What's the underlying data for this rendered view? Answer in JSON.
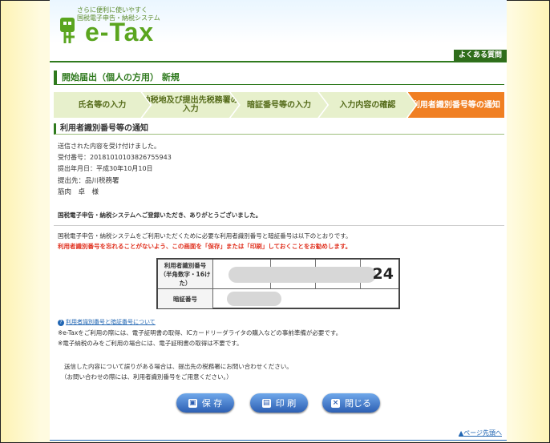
{
  "header": {
    "tagline_line1": "さらに便利に使いやすく",
    "tagline_line2": "国税電子申告・納税システム",
    "logo_text": "e-Tax",
    "faq_link": "よくある質問"
  },
  "page_title": "開始届出（個人の方用） 新規",
  "steps": [
    {
      "label": "氏名等の入力"
    },
    {
      "label": "納税地及び提出先税務署の入力"
    },
    {
      "label": "暗証番号等の入力"
    },
    {
      "label": "入力内容の確認"
    },
    {
      "label": "利用者識別番号等の通知"
    }
  ],
  "section_title": "利用者識別番号等の通知",
  "info": {
    "received": "送信された内容を受け付けました。",
    "receipt_no": "受付番号：20181010103826755943",
    "submit_date": "提出年月日：平成30年10月10日",
    "submit_to": "提出先：品川税務署",
    "name": "筋肉　卓　様",
    "thanks": "国税電子申告・納税システムへご登録いただき、ありがとうございました。"
  },
  "notice": {
    "line1": "国税電子申告・納税システムをご利用いただくために必要な利用者識別番号と暗証番号は以下のとおりです。",
    "line2": "利用者識別番号を忘れることがないよう、この画面を「保存」または「印刷」しておくことをお勧めします。"
  },
  "id_table": {
    "id_label_line1": "利用者識別番号",
    "id_label_line2": "（半角数字・16けた）",
    "id_suffix": "24",
    "pin_label": "暗証番号"
  },
  "links": {
    "about": "利用者識別番号と暗証番号について"
  },
  "notes": {
    "note1": "※e-Taxをご利用の際には、電子証明書の取得、ICカードリーダライタの購入などの事前準備が必要です。",
    "note2": "※電子納税のみをご利用の場合には、電子証明書の取得は不要です。",
    "contact1": "送信した内容について誤りがある場合は、提出先の税務署にお問い合わせください。",
    "contact2": "（お問い合わせの際には、利用者識別番号をご用意ください。）"
  },
  "buttons": {
    "save": "保 存",
    "print": "印 刷",
    "close": "閉じる"
  },
  "page_top": "ページ先頭へ"
}
